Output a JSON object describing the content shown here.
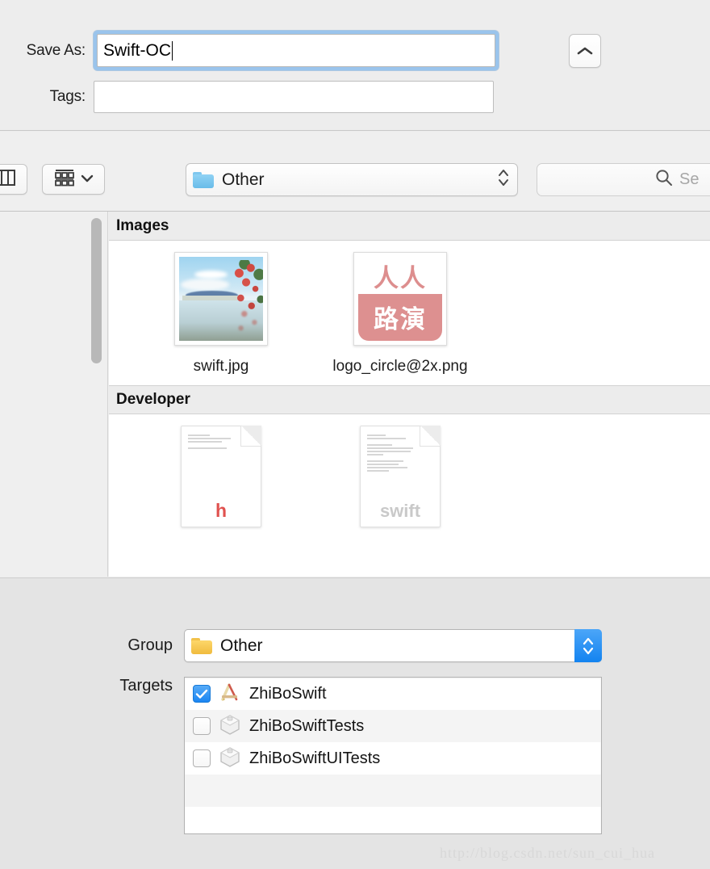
{
  "save_panel": {
    "save_as_label": "Save As:",
    "save_as_value": "Swift-OC",
    "tags_label": "Tags:",
    "tags_value": "",
    "tags_placeholder": "",
    "disclosure_icon": "chevron-up-icon"
  },
  "toolbar": {
    "column_view_icon": "column-view-icon",
    "arrange_icon": "icon-view-grid-icon",
    "arrange_chevron_icon": "chevron-down-icon",
    "location_label": "Other",
    "location_folder_icon": "folder-icon-blue",
    "location_stepper_icon": "stepper-updown-icon",
    "search_placeholder": "Se",
    "search_icon": "search-icon"
  },
  "browser": {
    "scrollbar_icon": "vertical-scrollbar-thumb",
    "sections": [
      {
        "title": "Images",
        "files": [
          {
            "name": "swift.jpg",
            "icon": "image-thumbnail-landscape"
          },
          {
            "name": "logo_circle@2x.png",
            "icon": "image-thumbnail-logo"
          }
        ]
      },
      {
        "title": "Developer",
        "files": [
          {
            "name": "",
            "icon": "source-file-h-icon",
            "badge": "h"
          },
          {
            "name": "",
            "icon": "source-file-swift-icon",
            "badge": "swift"
          }
        ]
      }
    ],
    "logo_thumbnail": {
      "top_text": "人人",
      "bottom_text": "路演",
      "accent": "#dd9090"
    }
  },
  "destination": {
    "group_label": "Group",
    "group_value": "Other",
    "group_folder_icon": "folder-icon-yellow",
    "group_stepper_icon": "stepper-updown-icon",
    "targets_label": "Targets",
    "targets": [
      {
        "name": "ZhiBoSwift",
        "checked": true,
        "icon": "xcode-app-icon"
      },
      {
        "name": "ZhiBoSwiftTests",
        "checked": false,
        "icon": "test-bundle-icon"
      },
      {
        "name": "ZhiBoSwiftUITests",
        "checked": false,
        "icon": "test-bundle-icon"
      }
    ]
  },
  "watermark": {
    "text": "http://blog.csdn.net/sun_cui_hua"
  },
  "colors": {
    "accent_blue": "#1b85f2",
    "focus_ring": "#9ac4ec",
    "logo_salmon": "#dd9090",
    "folder_blue": "#7fc7ee",
    "folder_yellow": "#f0bb3e"
  }
}
